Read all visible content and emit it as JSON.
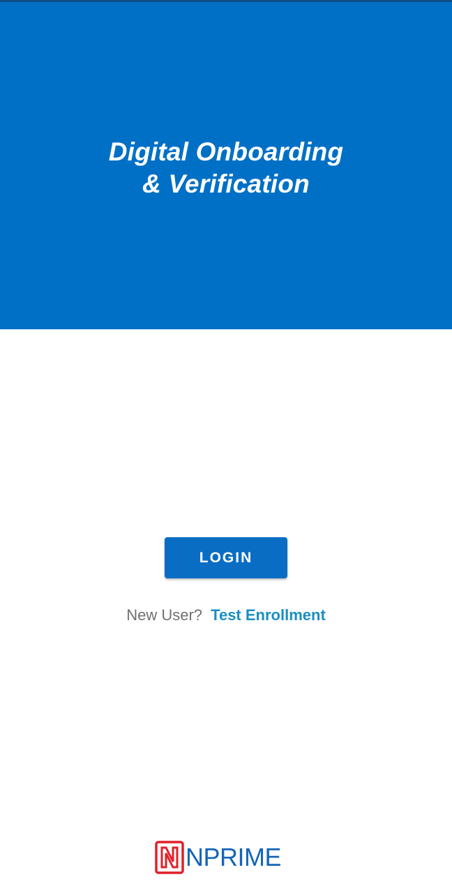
{
  "hero": {
    "title_line1": "Digital Onboarding",
    "title_line2": "& Verification",
    "background_color": "#0070c6"
  },
  "auth": {
    "login_label": "LOGIN",
    "new_user_label": "New User?",
    "enroll_link_label": "Test Enrollment"
  },
  "footer": {
    "logo_text": "NPRIME",
    "logo_icon": "nprime-n-logo-icon",
    "logo_mark_color": "#e0202a",
    "logo_text_color": "#1565b8"
  },
  "colors": {
    "accent": "#0a6dc4",
    "link": "#1a8fc2"
  }
}
